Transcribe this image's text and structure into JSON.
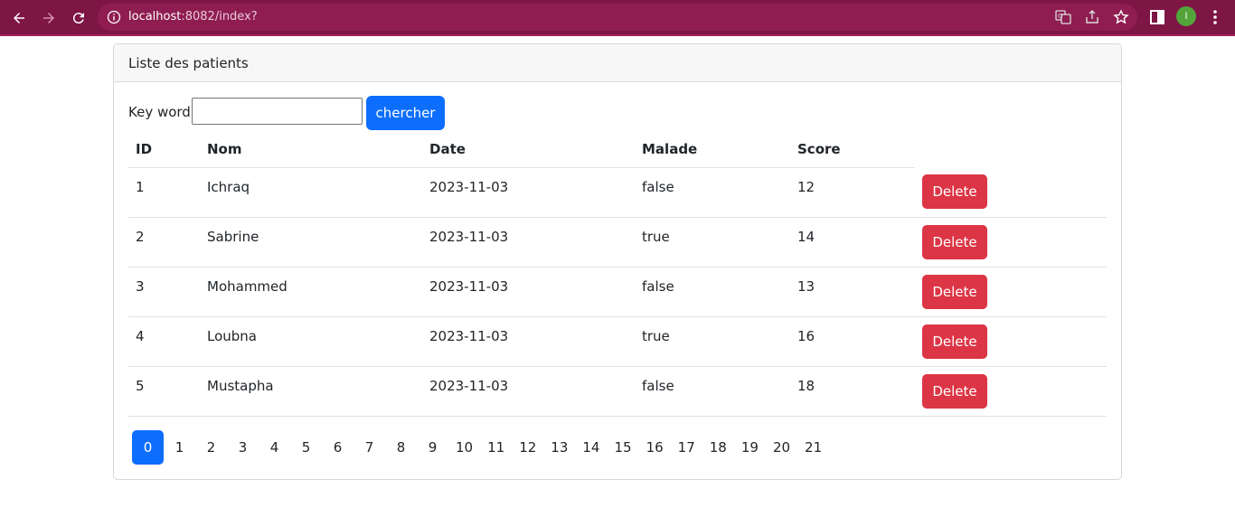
{
  "browser": {
    "url_host": "localhost",
    "url_rest": ":8082/index?",
    "avatar_letter": "I"
  },
  "card": {
    "title": "Liste des patients"
  },
  "search": {
    "label": "Key word",
    "value": "",
    "button_label": "chercher"
  },
  "table": {
    "headers": [
      "ID",
      "Nom",
      "Date",
      "Malade",
      "Score"
    ],
    "rows": [
      {
        "id": "1",
        "nom": "Ichraq",
        "date": "2023-11-03",
        "malade": "false",
        "score": "12",
        "action": "Delete"
      },
      {
        "id": "2",
        "nom": "Sabrine",
        "date": "2023-11-03",
        "malade": "true",
        "score": "14",
        "action": "Delete"
      },
      {
        "id": "3",
        "nom": "Mohammed",
        "date": "2023-11-03",
        "malade": "false",
        "score": "13",
        "action": "Delete"
      },
      {
        "id": "4",
        "nom": "Loubna",
        "date": "2023-11-03",
        "malade": "true",
        "score": "16",
        "action": "Delete"
      },
      {
        "id": "5",
        "nom": "Mustapha",
        "date": "2023-11-03",
        "malade": "false",
        "score": "18",
        "action": "Delete"
      }
    ]
  },
  "pagination": {
    "pages": [
      "0",
      "1",
      "2",
      "3",
      "4",
      "5",
      "6",
      "7",
      "8",
      "9",
      "10",
      "11",
      "12",
      "13",
      "14",
      "15",
      "16",
      "17",
      "18",
      "19",
      "20",
      "21"
    ],
    "current": "0"
  },
  "colors": {
    "toolbar": "#7d1545",
    "primary": "#0d6efd",
    "danger": "#dc3545"
  }
}
